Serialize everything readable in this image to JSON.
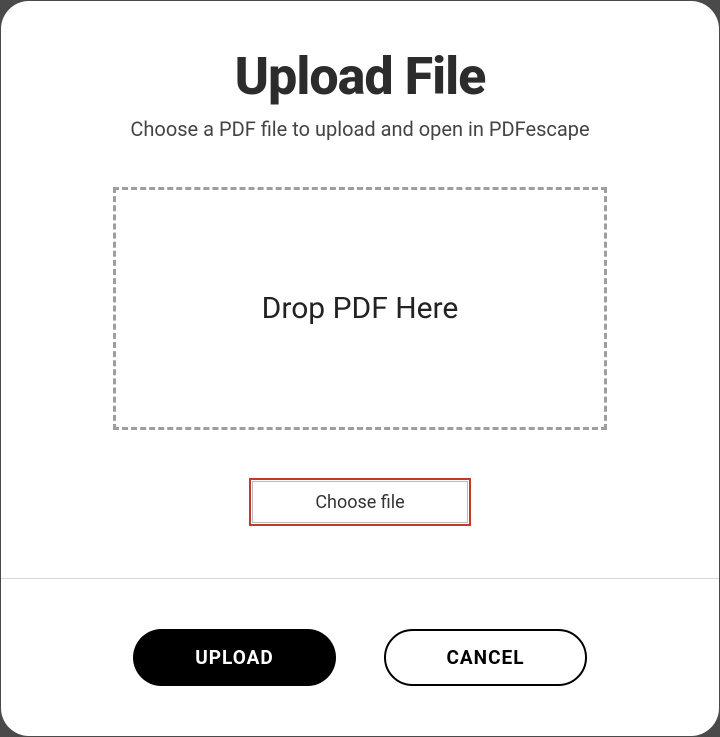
{
  "modal": {
    "title": "Upload File",
    "subtitle": "Choose a PDF file to upload and open in PDFescape",
    "dropzone": {
      "text": "Drop PDF Here"
    },
    "choose_file_label": "Choose file"
  },
  "footer": {
    "upload_label": "UPLOAD",
    "cancel_label": "CANCEL"
  }
}
